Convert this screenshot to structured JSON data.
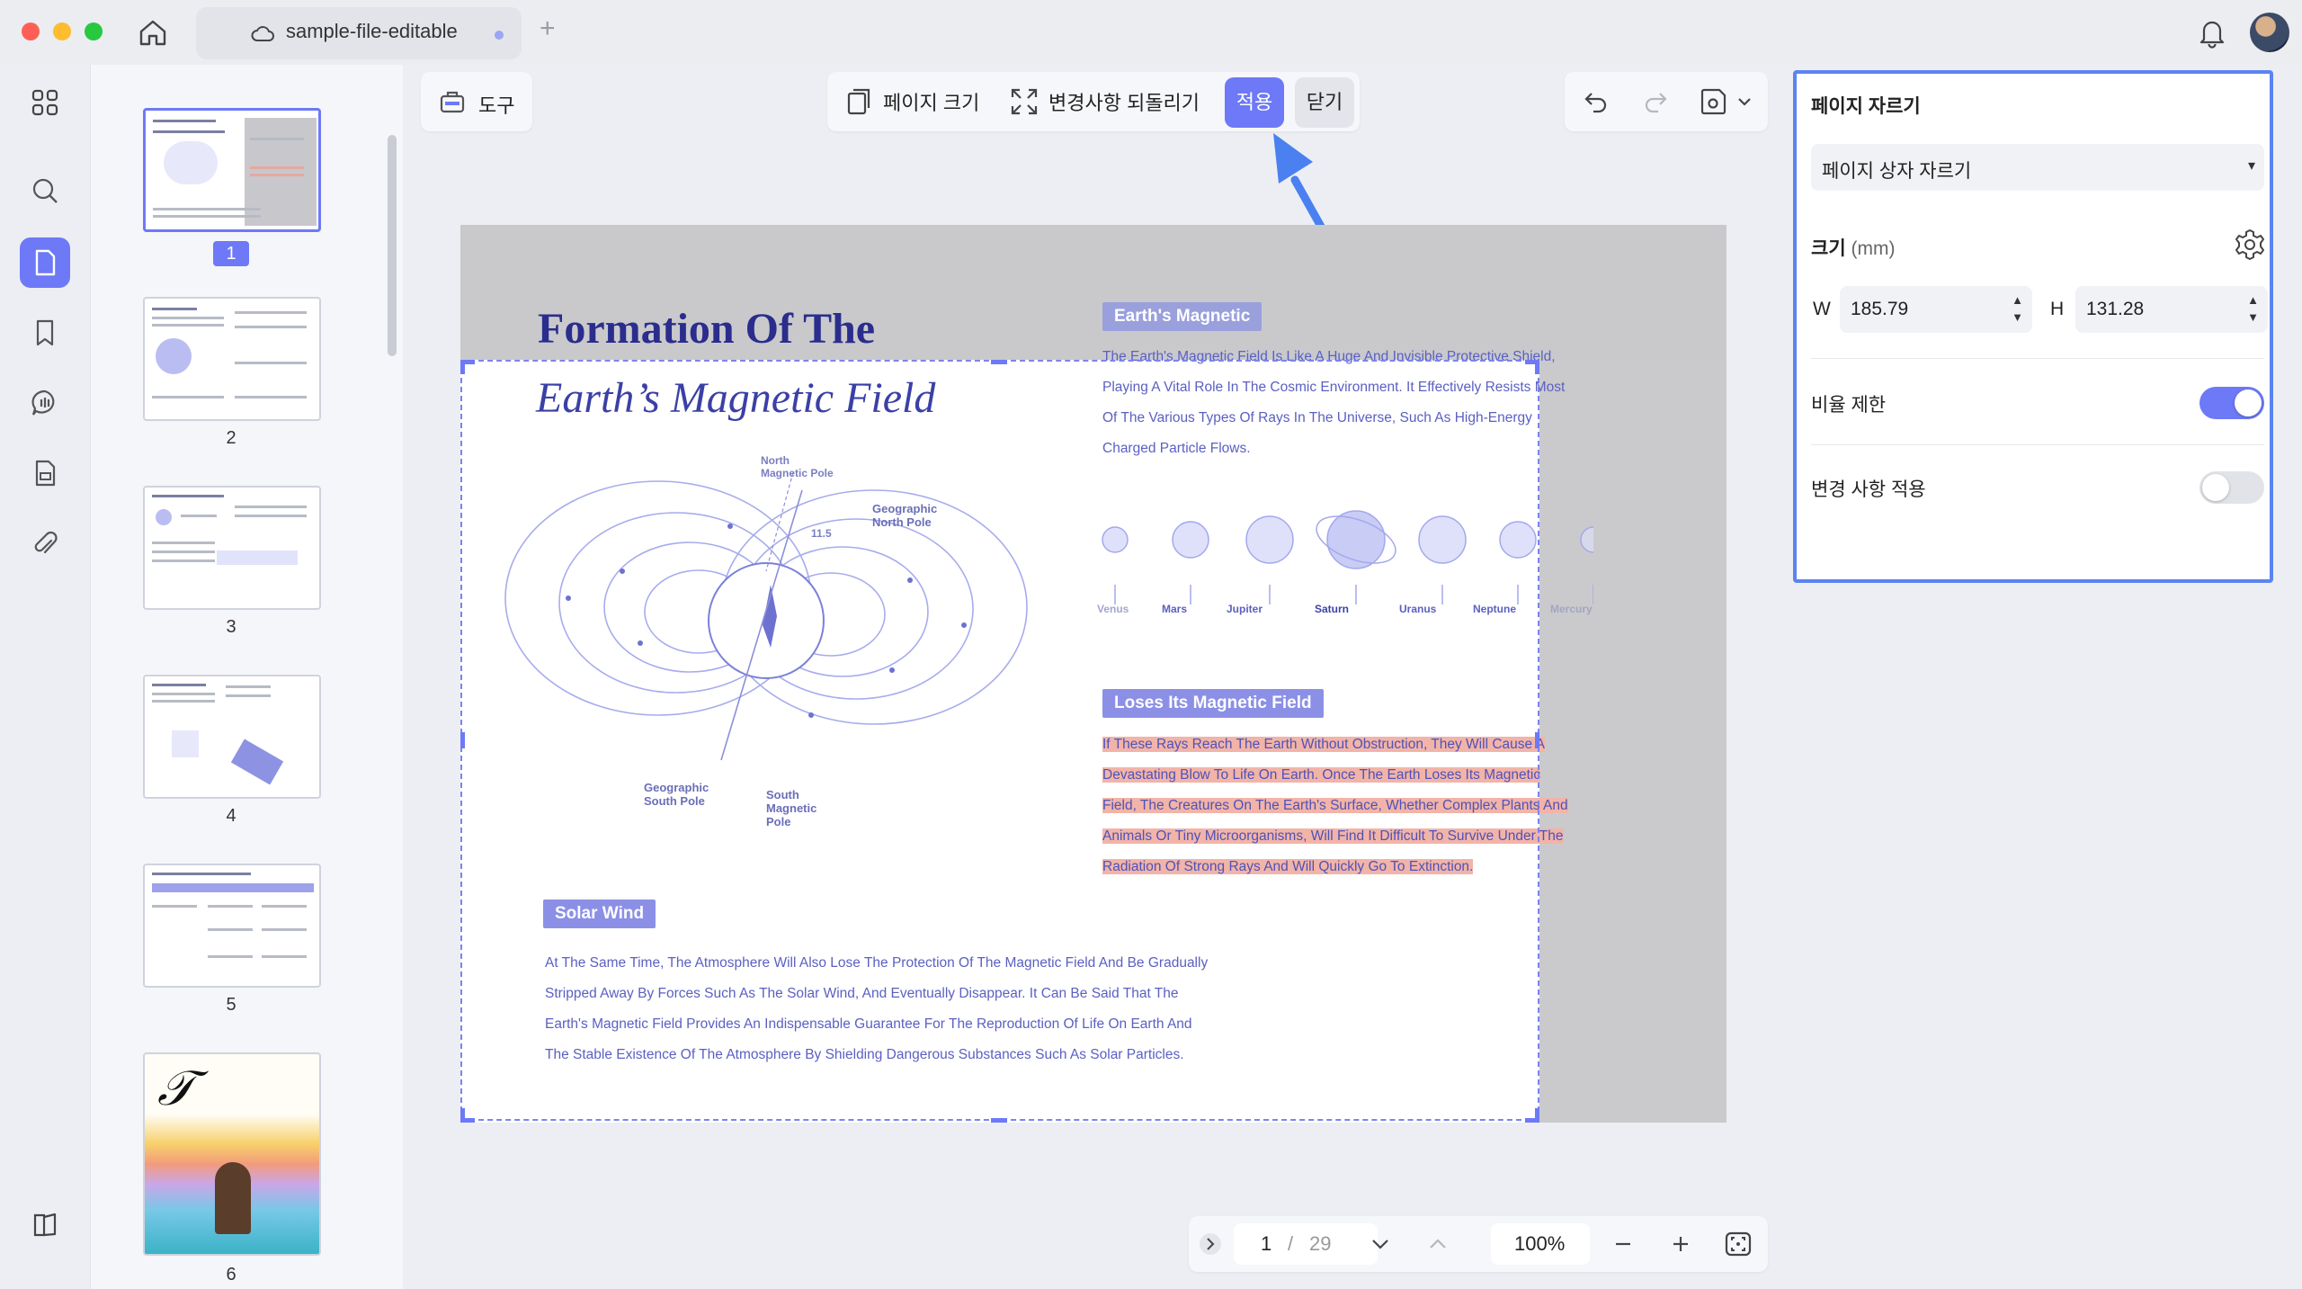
{
  "window": {
    "tab_title": "sample-file-editable",
    "tab_add": "+"
  },
  "toolbar": {
    "tools_label": "도구",
    "page_size_label": "페이지 크기",
    "revert_label": "변경사항 되돌리기",
    "apply_label": "적용",
    "close_label": "닫기"
  },
  "thumbnails": [
    {
      "num": "1",
      "selected": true
    },
    {
      "num": "2"
    },
    {
      "num": "3"
    },
    {
      "num": "4"
    },
    {
      "num": "5"
    },
    {
      "num": "6"
    }
  ],
  "page": {
    "title_line1": "Formation Of The",
    "title_line2": "Earth’s Magnetic Field",
    "tag_magnetic": "Earth's Magnetic",
    "magnetic_text": [
      "The Earth's Magnetic Field Is Like A Huge And Invisible Protective Shield,",
      "Playing A Vital Role In The Cosmic Environment. It Effectively Resists Most",
      "Of The Various Types Of Rays In The Universe, Such As High-Energy",
      "Charged Particle Flows."
    ],
    "planets": [
      "Venus",
      "Mars",
      "Jupiter",
      "Saturn",
      "Uranus",
      "Neptune",
      "Mercury"
    ],
    "tag_loses": "Loses Its Magnetic Field",
    "loses_text": [
      "If These Rays Reach The Earth Without Obstruction, They Will Cause A",
      "Devastating Blow To Life On Earth. Once The Earth Loses Its Magnetic",
      "Field, The Creatures On The Earth's Surface, Whether Complex Plants And",
      "Animals Or Tiny Microorganisms, Will Find It Difficult To Survive Under The",
      "Radiation Of Strong Rays And Will Quickly Go To Extinction."
    ],
    "tag_solar": "Solar Wind",
    "solar_text": [
      "At The Same Time, The Atmosphere Will Also Lose The Protection Of The Magnetic Field And Be Gradually",
      "Stripped Away By Forces Such As The Solar Wind, And Eventually Disappear. It Can Be Said That The",
      "Earth's Magnetic Field Provides An Indispensable Guarantee For The Reproduction Of Life On Earth And",
      "The Stable Existence Of The Atmosphere By Shielding Dangerous Substances Such As Solar Particles."
    ],
    "diagram_labels": {
      "north_magnetic": "North\nMagnetic Pole",
      "geo_north": "Geographic\nNorth Pole",
      "geo_south": "Geographic\nSouth Pole",
      "south_magnetic": "South\nMagnetic\nPole",
      "angle": "11.5"
    }
  },
  "nav": {
    "current_page": "1",
    "separator": "/",
    "total_pages": "29",
    "zoom": "100%"
  },
  "crop_panel": {
    "title": "페이지 자르기",
    "mode": "페이지 상자 자르기",
    "size_label": "크기",
    "size_unit": "(mm)",
    "w_label": "W",
    "w_value": "185.79",
    "h_label": "H",
    "h_value": "131.28",
    "ratio_label": "비율 제한",
    "ratio_on": true,
    "apply_changes_label": "변경 사항 적용",
    "apply_changes_on": false
  },
  "colors": {
    "accent": "#6d79f6",
    "panel_border": "#5b84f0",
    "highlight": "#f2b4a8"
  }
}
